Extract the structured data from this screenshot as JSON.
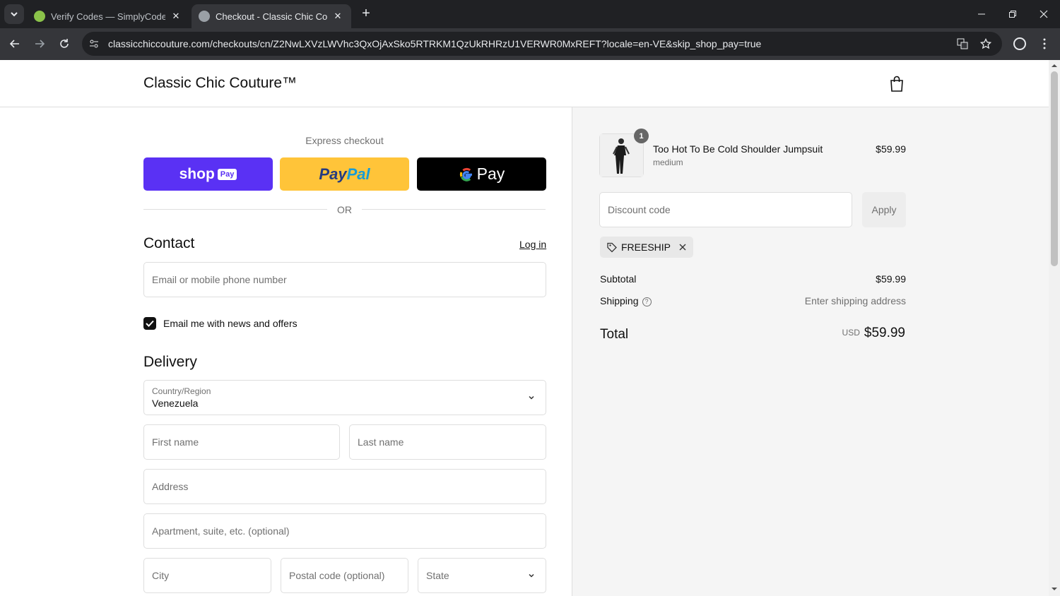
{
  "browser": {
    "tabs": [
      {
        "title": "Verify Codes — SimplyCodes",
        "favicon_color": "#8bc34a"
      },
      {
        "title": "Checkout - Classic Chic Couture",
        "favicon_color": "#9aa0a6"
      }
    ],
    "close_symbol": "✕",
    "new_tab_symbol": "+",
    "url": "classicchiccouture.com/checkouts/cn/Z2NwLXVzLWVhc3QxOjAxSko5RTRKM1QzUkRHRzU1VERWR0MxREFT?locale=en-VE&skip_shop_pay=true",
    "icons": [
      "back-arrow-icon",
      "forward-arrow-icon",
      "reload-icon",
      "site-info-icon",
      "translate-icon",
      "bookmark-star-icon",
      "profile-icon",
      "menu-dots-icon"
    ]
  },
  "header": {
    "brand": "Classic Chic Couture™"
  },
  "express": {
    "title": "Express checkout",
    "shop_label": "shop",
    "shop_pill": "Pay",
    "paypal_label": "PayPal",
    "gpay_label": "Pay",
    "or_text": "OR"
  },
  "contact": {
    "title": "Contact",
    "login_link": "Log in",
    "email_placeholder": "Email or mobile phone number",
    "newsletter_label": "Email me with news and offers",
    "newsletter_checked": true
  },
  "delivery": {
    "title": "Delivery",
    "country_label": "Country/Region",
    "country_value": "Venezuela",
    "first_name_placeholder": "First name",
    "last_name_placeholder": "Last name",
    "address_placeholder": "Address",
    "apartment_placeholder": "Apartment, suite, etc. (optional)",
    "city_placeholder": "City",
    "postal_placeholder": "Postal code (optional)",
    "state_placeholder": "State"
  },
  "summary": {
    "item": {
      "name": "Too Hot To Be Cold Shoulder Jumpsuit",
      "variant": "medium",
      "price": "$59.99",
      "quantity": "1"
    },
    "discount_placeholder": "Discount code",
    "apply_label": "Apply",
    "applied_code": "FREESHIP",
    "subtotal_label": "Subtotal",
    "subtotal_value": "$59.99",
    "shipping_label": "Shipping",
    "shipping_value": "Enter shipping address",
    "total_label": "Total",
    "total_currency": "USD",
    "total_value": "$59.99"
  },
  "colors": {
    "shop_pay": "#5a31f4",
    "paypal": "#ffc439",
    "gpay": "#000000",
    "aside_bg": "#f5f5f5"
  }
}
